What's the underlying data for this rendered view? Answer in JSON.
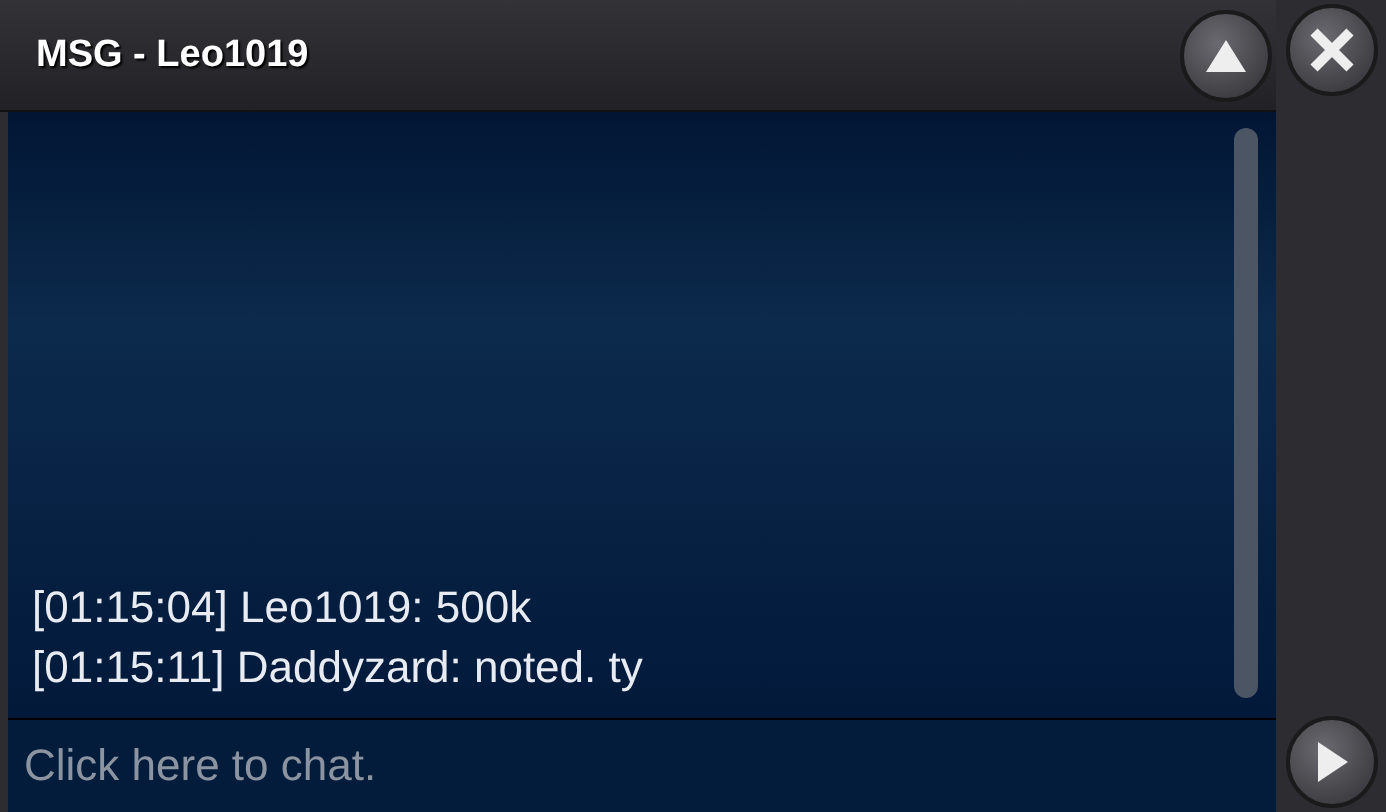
{
  "window": {
    "title": "MSG - Leo1019"
  },
  "messages": [
    {
      "time": "[01:15:04]",
      "text": "Leo1019: 500k"
    },
    {
      "time": "[01:15:11]",
      "text": "Daddyzard: noted. ty"
    }
  ],
  "input": {
    "placeholder": "Click here to chat."
  }
}
